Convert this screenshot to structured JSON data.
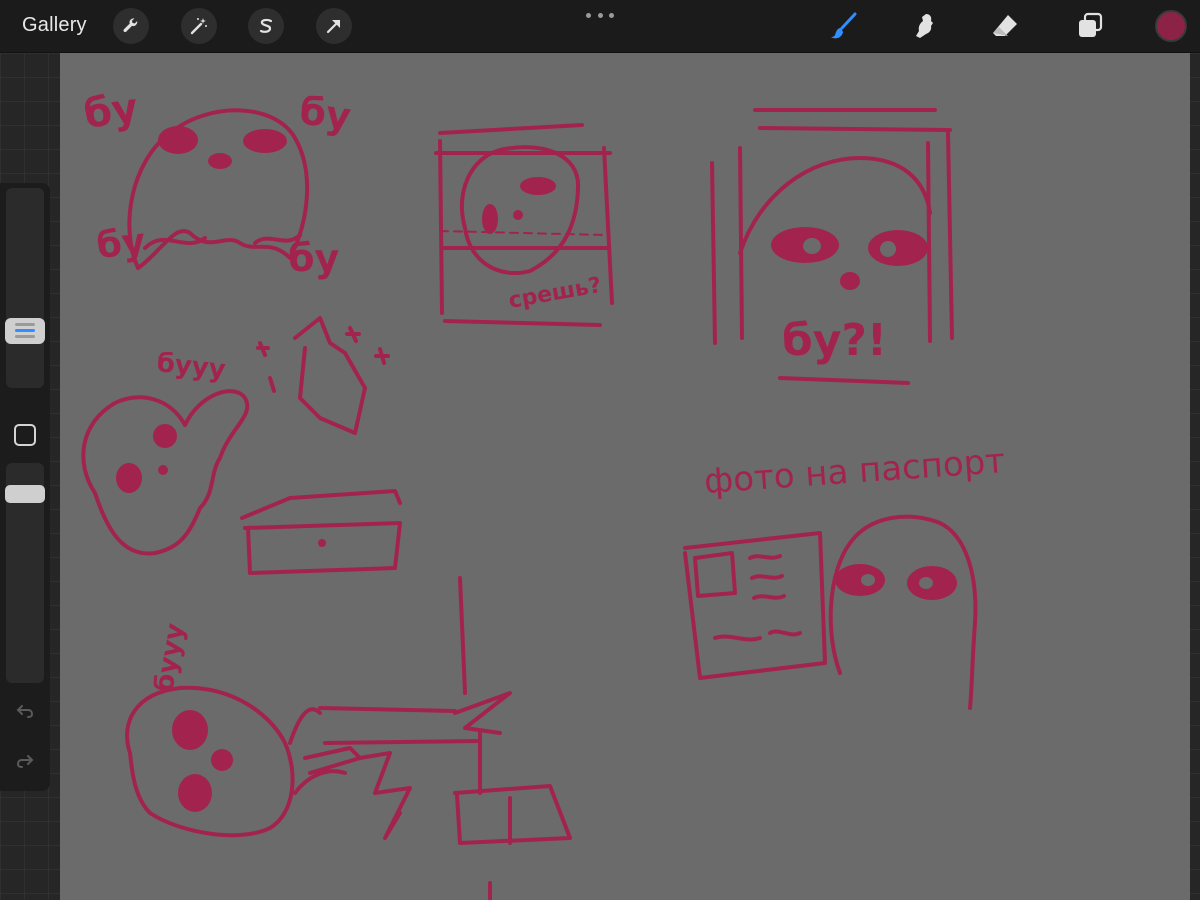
{
  "topbar": {
    "gallery_label": "Gallery",
    "left_tools": [
      "wrench-icon",
      "magic-wand-icon",
      "selection-s-icon",
      "transform-arrow-icon"
    ],
    "right_tools": [
      "brush-icon",
      "smudge-icon",
      "eraser-icon",
      "layers-icon"
    ],
    "active_tool": "brush",
    "active_color": "#8c2346",
    "brush_active_color": "#2f8fff"
  },
  "sidebar": {
    "brush_size_active_color": "#2f8fff",
    "modifier_icon": "square-icon",
    "undo_icon": "undo-icon",
    "redo_icon": "redo-icon"
  },
  "canvas": {
    "background": "#6b6b6b",
    "ink_color": "#a3234f",
    "texts": {
      "by_top_left": "бу",
      "by_top_right": "бу",
      "by_mid_left": "бу",
      "by_mid_right": "бу",
      "strashno": "срешь?",
      "by_big": "бу?!",
      "buuu": "бууу",
      "photo_passport": "фото на паспорт",
      "buuu_vertical": "бууу"
    }
  }
}
